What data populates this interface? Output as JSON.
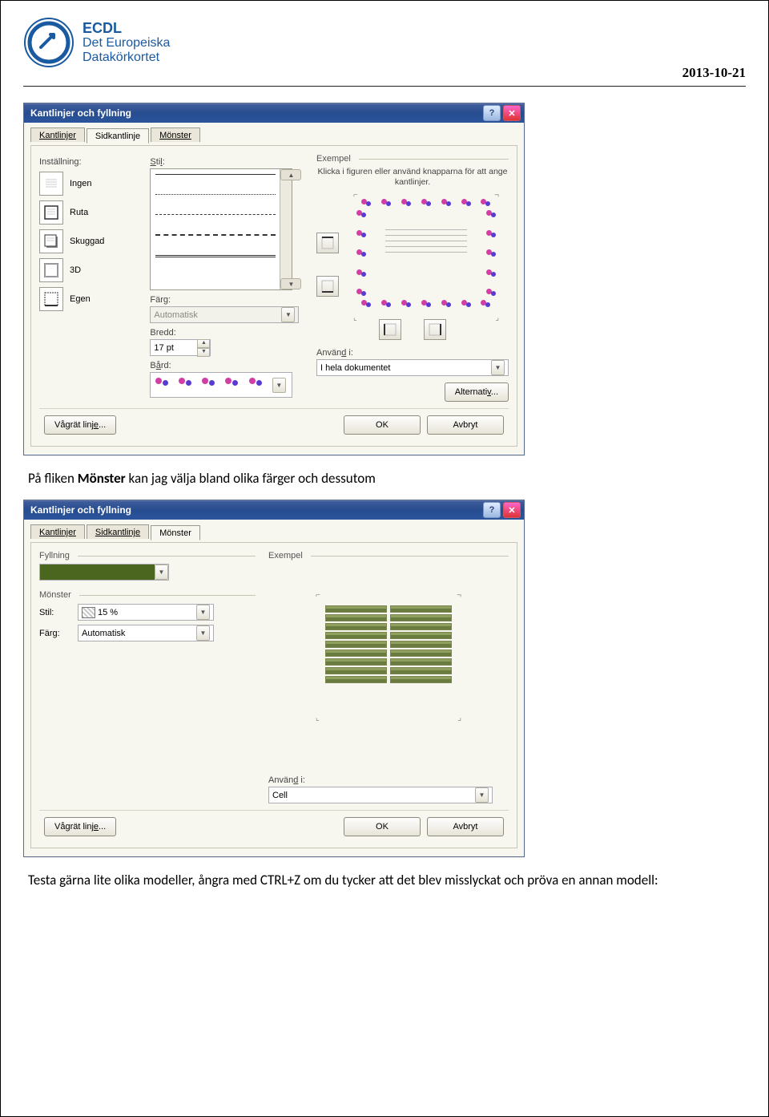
{
  "header": {
    "brand_line1": "ECDL",
    "brand_line2": "Det Europeiska",
    "brand_line3": "Datakörkortet",
    "date": "2013-10-21"
  },
  "dialog1": {
    "title": "Kantlinjer och fyllning",
    "tabs": {
      "borders": "Kantlinjer",
      "page_border": "Sidkantlinje",
      "pattern": "Mönster"
    },
    "setting_label": "Inställning:",
    "settings": {
      "none": "Ingen",
      "box": "Ruta",
      "shadow": "Skuggad",
      "threeD": "3D",
      "custom": "Egen"
    },
    "style_label": "Stil:",
    "color_label": "Färg:",
    "color_value": "Automatisk",
    "width_label": "Bredd:",
    "width_value": "17 pt",
    "bard_label": "Bård:",
    "example_label": "Exempel",
    "example_caption": "Klicka i figuren eller använd knapparna för att ange kantlinjer.",
    "apply_label": "Använd i:",
    "apply_value": "I hela dokumentet",
    "alternativ": "Alternativ...",
    "hline": "Vågrät linje...",
    "ok": "OK",
    "cancel": "Avbryt"
  },
  "para1_pre": "På fliken ",
  "para1_bold": "Mönster",
  "para1_post": " kan jag välja bland olika färger och dessutom",
  "dialog2": {
    "title": "Kantlinjer och fyllning",
    "tabs": {
      "borders": "Kantlinjer",
      "page_border": "Sidkantlinje",
      "pattern": "Mönster"
    },
    "fill_label": "Fyllning",
    "pattern_label": "Mönster",
    "stil_label": "Stil:",
    "stil_value": "15 %",
    "color_label": "Färg:",
    "color_value": "Automatisk",
    "example_label": "Exempel",
    "apply_label": "Använd i:",
    "apply_value": "Cell",
    "hline": "Vågrät linje...",
    "ok": "OK",
    "cancel": "Avbryt"
  },
  "para2": "Testa gärna lite olika modeller, ångra med CTRL+Z om du tycker att det blev misslyckat och pröva en annan modell:"
}
